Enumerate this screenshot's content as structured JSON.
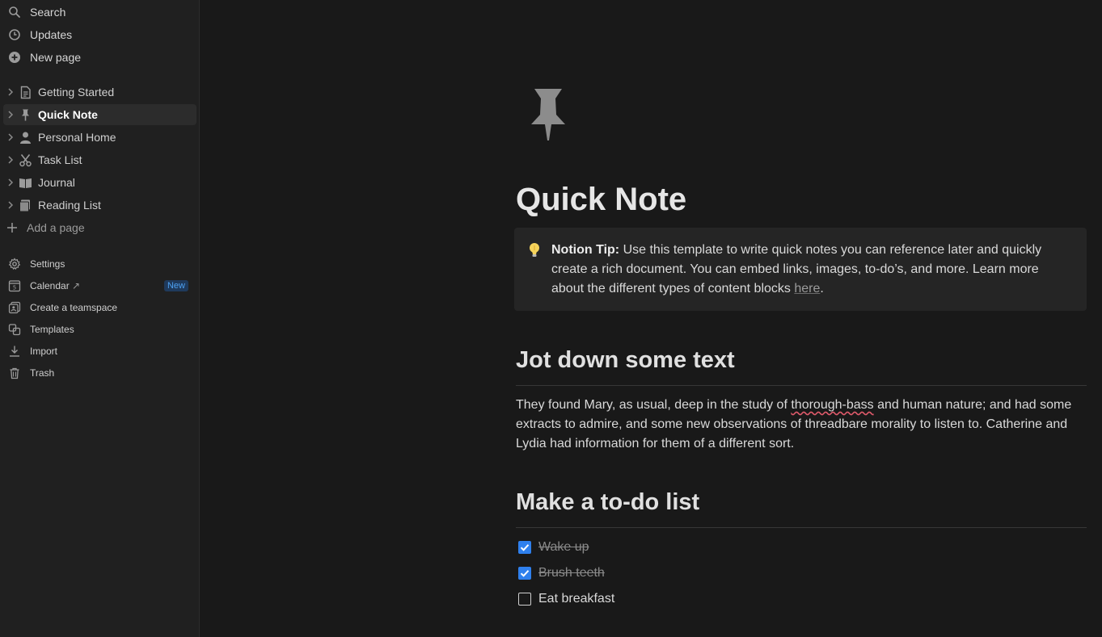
{
  "sidebar": {
    "top_items": [
      {
        "label": "Search",
        "icon": "search-icon"
      },
      {
        "label": "Updates",
        "icon": "clock-icon"
      },
      {
        "label": "New page",
        "icon": "plus-circle-icon"
      }
    ],
    "pages": [
      {
        "label": "Getting Started",
        "icon": "document-icon"
      },
      {
        "label": "Quick Note",
        "icon": "pushpin-icon",
        "active": true
      },
      {
        "label": "Personal Home",
        "icon": "person-icon"
      },
      {
        "label": "Task List",
        "icon": "scissors-icon"
      },
      {
        "label": "Journal",
        "icon": "open-book-icon"
      },
      {
        "label": "Reading List",
        "icon": "books-icon"
      }
    ],
    "add_page_label": "Add a page",
    "utility_items": [
      {
        "label": "Settings",
        "icon": "gear-icon"
      },
      {
        "label": "Calendar",
        "icon": "calendar-icon",
        "badge": "New"
      },
      {
        "label": "Create a teamspace",
        "icon": "teamspace-icon"
      },
      {
        "label": "Templates",
        "icon": "templates-icon"
      },
      {
        "label": "Import",
        "icon": "import-icon"
      },
      {
        "label": "Trash",
        "icon": "trash-icon"
      }
    ],
    "calendar_day": "5",
    "calendar_arrow": "↗"
  },
  "page": {
    "icon": "pushpin-icon",
    "title": "Quick Note",
    "callout": {
      "icon": "lightbulb-icon",
      "bold": "Notion Tip:",
      "text": " Use this template to write quick notes you can reference later and quickly create a rich document. You can embed links, images, to-do’s, and more. Learn more about the different types of content blocks ",
      "link": "here",
      "end": "."
    },
    "section1": {
      "heading": "Jot down some text",
      "para_before": "They found Mary, as usual, deep in the study of ",
      "para_misspelled": "thorough-bass",
      "para_after": " and human nature; and had some extracts to admire, and some new observations of threadbare morality to listen to. Catherine and Lydia had information for them of a different sort."
    },
    "section2": {
      "heading": "Make a to-do list",
      "todos": [
        {
          "label": "Wake up",
          "checked": true
        },
        {
          "label": "Brush teeth",
          "checked": true
        },
        {
          "label": "Eat breakfast",
          "checked": false
        }
      ]
    }
  },
  "colors": {
    "background": "#191919",
    "sidebar": "#202020",
    "accent": "#2f80ed",
    "badge_text": "#4ea0f0"
  }
}
